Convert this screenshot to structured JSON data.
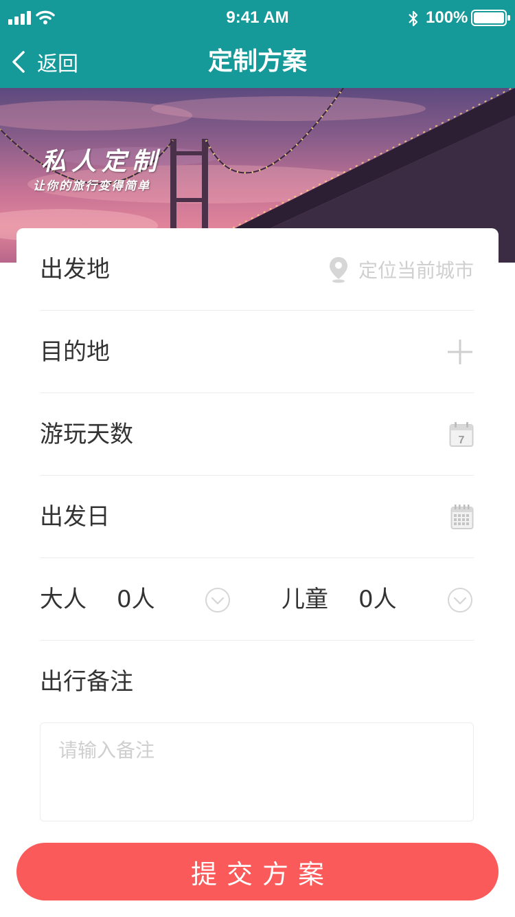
{
  "status_bar": {
    "time": "9:41 AM",
    "battery": "100%"
  },
  "nav": {
    "back_label": "返回",
    "title": "定制方案"
  },
  "hero": {
    "title": "私人定制",
    "subtitle": "让你的旅行变得简单"
  },
  "form": {
    "departure": {
      "label": "出发地",
      "placeholder": "定位当前城市",
      "icon": "location-pin-icon"
    },
    "destination": {
      "label": "目的地",
      "icon": "plus-icon"
    },
    "days": {
      "label": "游玩天数",
      "icon": "calendar-7-icon"
    },
    "date": {
      "label": "出发日",
      "icon": "calendar-grid-icon"
    },
    "travelers": {
      "adults_label": "大人",
      "adults_value": "0人",
      "children_label": "儿童",
      "children_value": "0人",
      "icon": "chevron-down-circle-icon"
    },
    "notes": {
      "label": "出行备注",
      "placeholder": "请输入备注"
    }
  },
  "submit_label": "提交方案",
  "colors": {
    "header": "#169a99",
    "submit": "#fa5a5a",
    "divider": "#ececec",
    "placeholder": "#cfcfcf"
  }
}
